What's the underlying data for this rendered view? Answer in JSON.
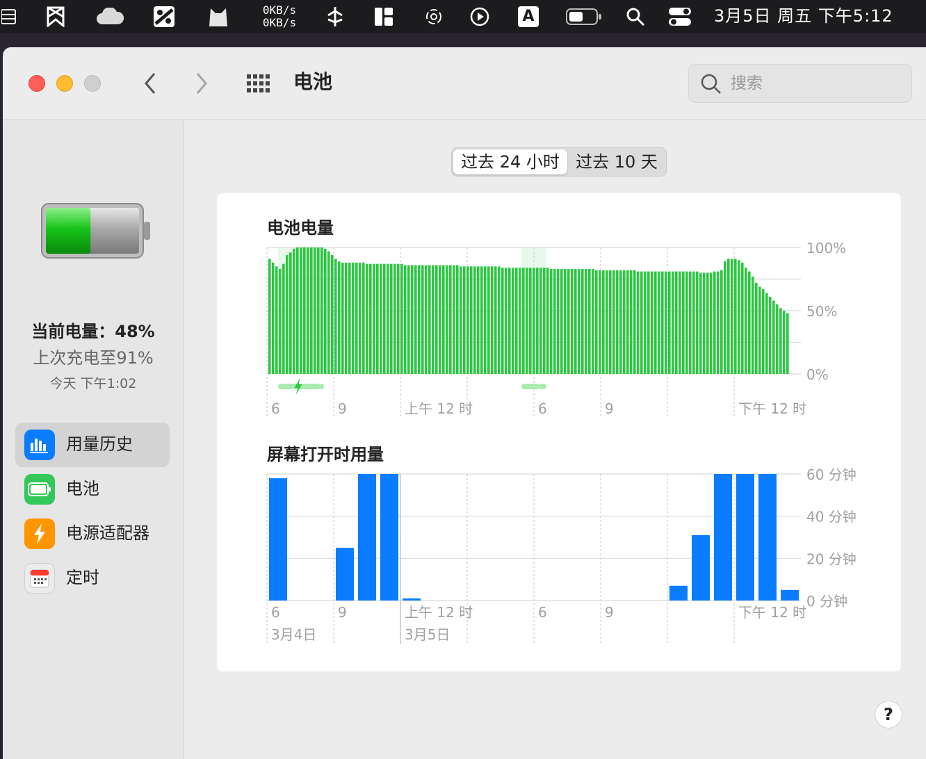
{
  "menubar": {
    "net_up": "0KB/s",
    "net_down": "0KB/s",
    "clock": "3月5日 周五 下午5:12",
    "icons": [
      "menu-extra-icon",
      "bookmark-icon",
      "cloud-icon",
      "scale-icon",
      "cat-icon",
      "network-speed-icon",
      "bluetooth-icon",
      "layout-icon",
      "sync-icon",
      "play-icon",
      "input-method-icon",
      "battery-icon",
      "spotlight-search-icon",
      "control-center-icon"
    ],
    "input_method_label": "A"
  },
  "window": {
    "title": "电池",
    "search_placeholder": "搜索"
  },
  "sidebar": {
    "battery_level_fraction": 0.48,
    "current_level": "当前电量：48%",
    "last_charged": "上次充电至91%",
    "last_charged_time": "今天 下午1:02",
    "items": [
      {
        "label": "用量历史",
        "icon": "usage-history-icon",
        "active": true,
        "color": "#0a7cff"
      },
      {
        "label": "电池",
        "icon": "battery-icon",
        "active": false,
        "color": "#34c759"
      },
      {
        "label": "电源适配器",
        "icon": "power-adapter-icon",
        "active": false,
        "color": "#ff9500"
      },
      {
        "label": "定时",
        "icon": "schedule-icon",
        "active": false,
        "color": "#e6e6e6"
      }
    ]
  },
  "segmented": {
    "options": [
      "过去 24 小时",
      "过去 10 天"
    ],
    "selected": 0
  },
  "battery_chart_title": "电池电量",
  "screen_chart_title": "屏幕打开时用量",
  "x_axis_labels": [
    "6",
    "9",
    "上午 12 时",
    "6",
    "9",
    "下午 12 时"
  ],
  "date_labels": [
    "3月4日",
    "3月5日"
  ],
  "colors": {
    "battery_bar": "#2ac840",
    "charging": "#a8ecb0",
    "screen_bar": "#0a7cff",
    "grid": "#e0e0e0"
  },
  "chart_data": [
    {
      "type": "bar",
      "title": "电池电量",
      "unit": "%",
      "y_ticks": [
        "100%",
        "50%",
        "0%"
      ],
      "ylim": [
        0,
        100
      ],
      "x_ticks": [
        "6",
        "9",
        "上午 12 时",
        "6",
        "9",
        "下午 12 时"
      ],
      "interval_minutes": 15,
      "values": [
        91,
        88,
        85,
        83,
        87,
        94,
        96,
        99,
        100,
        100,
        100,
        100,
        100,
        100,
        100,
        100,
        99,
        97,
        94,
        91,
        89,
        88,
        88,
        88,
        88,
        88,
        88,
        88,
        87,
        87,
        87,
        87,
        87,
        87,
        87,
        87,
        87,
        87,
        87,
        86,
        86,
        86,
        86,
        86,
        86,
        86,
        86,
        86,
        86,
        86,
        86,
        86,
        86,
        86,
        86,
        85,
        85,
        85,
        85,
        85,
        85,
        85,
        85,
        85,
        85,
        85,
        85,
        84,
        84,
        84,
        84,
        84,
        84,
        84,
        84,
        84,
        84,
        84,
        84,
        84,
        84,
        83,
        83,
        83,
        83,
        83,
        83,
        83,
        83,
        83,
        83,
        83,
        83,
        83,
        82,
        82,
        82,
        82,
        82,
        82,
        82,
        82,
        82,
        82,
        82,
        82,
        81,
        81,
        81,
        81,
        81,
        81,
        81,
        81,
        81,
        81,
        81,
        81,
        81,
        81,
        81,
        81,
        81,
        81,
        80,
        80,
        80,
        80,
        81,
        81,
        82,
        89,
        91,
        91,
        91,
        90,
        88,
        84,
        81,
        77,
        72,
        69,
        67,
        64,
        61,
        58,
        55,
        52,
        50,
        48
      ],
      "charging_periods": [
        [
          3,
          14
        ],
        [
          15,
          15
        ],
        [
          73,
          77
        ],
        [
          78,
          79
        ]
      ],
      "charging_bolt_at": 8.5
    },
    {
      "type": "bar",
      "title": "屏幕打开时用量",
      "unit": "分钟",
      "y_ticks": [
        "60 分钟",
        "40 分钟",
        "20 分钟",
        "0 分钟"
      ],
      "ylim": [
        0,
        60
      ],
      "x_ticks": [
        "6",
        "9",
        "上午 12 时",
        "6",
        "9",
        "下午 12 时"
      ],
      "interval_minutes": 60,
      "values": [
        58,
        0,
        0,
        25,
        60,
        60,
        1,
        0,
        0,
        0,
        0,
        0,
        0,
        0,
        0,
        0,
        0,
        0,
        7,
        31,
        60,
        60,
        60,
        5
      ]
    }
  ]
}
